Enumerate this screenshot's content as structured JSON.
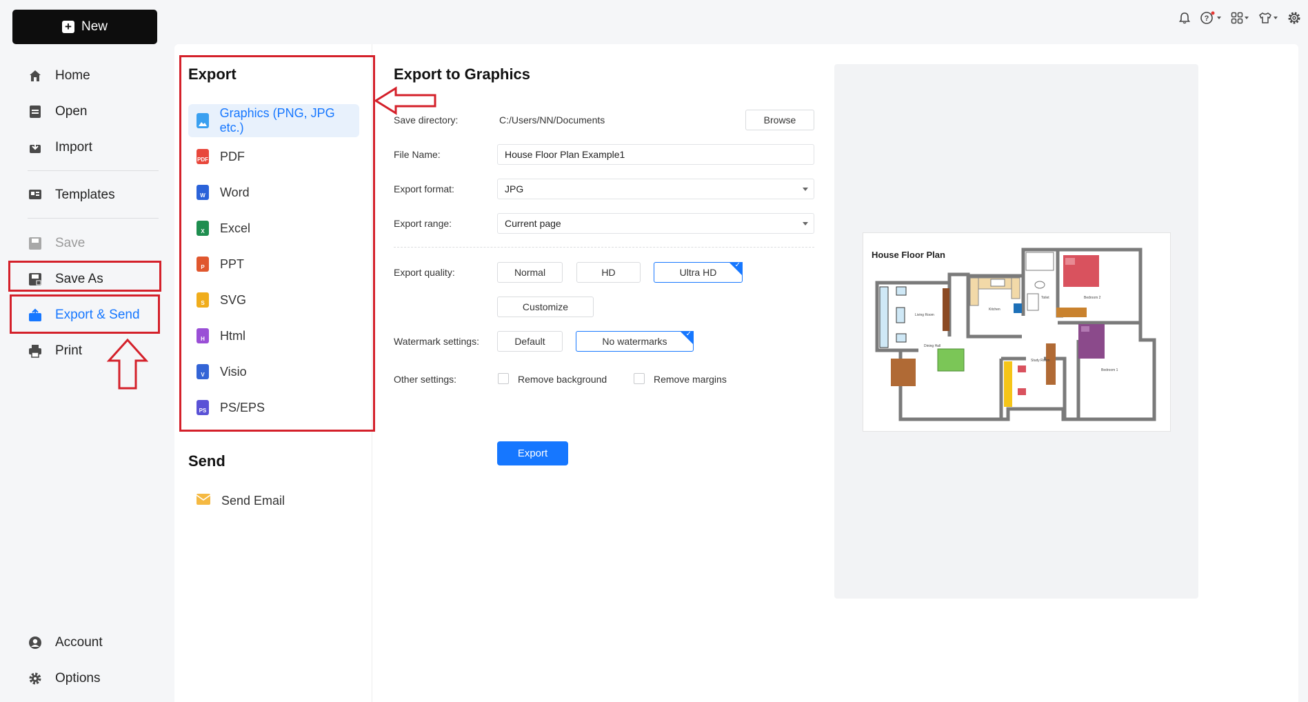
{
  "toolbar": {
    "new_label": "New"
  },
  "sidebar": {
    "items": [
      {
        "label": "Home",
        "icon": "home-icon"
      },
      {
        "label": "Open",
        "icon": "open-file-icon"
      },
      {
        "label": "Import",
        "icon": "import-icon"
      },
      {
        "label": "Templates",
        "icon": "templates-icon"
      },
      {
        "label": "Save",
        "icon": "save-icon",
        "disabled": true
      },
      {
        "label": "Save As",
        "icon": "save-as-icon"
      },
      {
        "label": "Export & Send",
        "icon": "export-icon",
        "active": true
      },
      {
        "label": "Print",
        "icon": "print-icon"
      }
    ],
    "bottom": [
      {
        "label": "Account",
        "icon": "account-icon"
      },
      {
        "label": "Options",
        "icon": "gear-icon"
      }
    ]
  },
  "export_panel": {
    "title": "Export",
    "items": [
      {
        "label": "Graphics (PNG, JPG etc.)",
        "icon": "image-file-icon",
        "color": "#3aa0f0",
        "active": true
      },
      {
        "label": "PDF",
        "icon": "pdf-file-icon",
        "color": "#e8473b"
      },
      {
        "label": "Word",
        "icon": "word-file-icon",
        "color": "#2b63d9"
      },
      {
        "label": "Excel",
        "icon": "excel-file-icon",
        "color": "#1e8e4f"
      },
      {
        "label": "PPT",
        "icon": "ppt-file-icon",
        "color": "#e0572e"
      },
      {
        "label": "SVG",
        "icon": "svg-file-icon",
        "color": "#f0ad1c"
      },
      {
        "label": "Html",
        "icon": "html-file-icon",
        "color": "#9a4fd6"
      },
      {
        "label": "Visio",
        "icon": "visio-file-icon",
        "color": "#3364d6"
      },
      {
        "label": "PS/EPS",
        "icon": "ps-file-icon",
        "color": "#5a52d6"
      }
    ],
    "send_title": "Send",
    "send_items": [
      {
        "label": "Send Email",
        "icon": "mail-icon",
        "color": "#f5b942"
      }
    ]
  },
  "form": {
    "title": "Export to Graphics",
    "save_directory_label": "Save directory:",
    "save_directory_value": "C:/Users/NN/Documents",
    "browse_label": "Browse",
    "file_name_label": "File Name:",
    "file_name_value": "House Floor Plan Example1",
    "export_format_label": "Export format:",
    "export_format_value": "JPG",
    "export_range_label": "Export range:",
    "export_range_value": "Current page",
    "export_quality_label": "Export quality:",
    "quality_options": [
      "Normal",
      "HD",
      "Ultra HD"
    ],
    "quality_selected": "Ultra HD",
    "customize_label": "Customize",
    "watermark_label": "Watermark settings:",
    "watermark_options": [
      "Default",
      "No watermarks"
    ],
    "watermark_selected": "No watermarks",
    "other_settings_label": "Other settings:",
    "remove_background_label": "Remove background",
    "remove_margins_label": "Remove margins",
    "export_button": "Export"
  },
  "preview": {
    "title": "House Floor Plan",
    "rooms": [
      "Living Room",
      "Kitchen",
      "Toilet",
      "Bedroom 2",
      "Dining Hall",
      "Study Room",
      "Bedroom 1"
    ]
  },
  "colors": {
    "accent": "#1677ff",
    "annotation": "#d4202a"
  }
}
